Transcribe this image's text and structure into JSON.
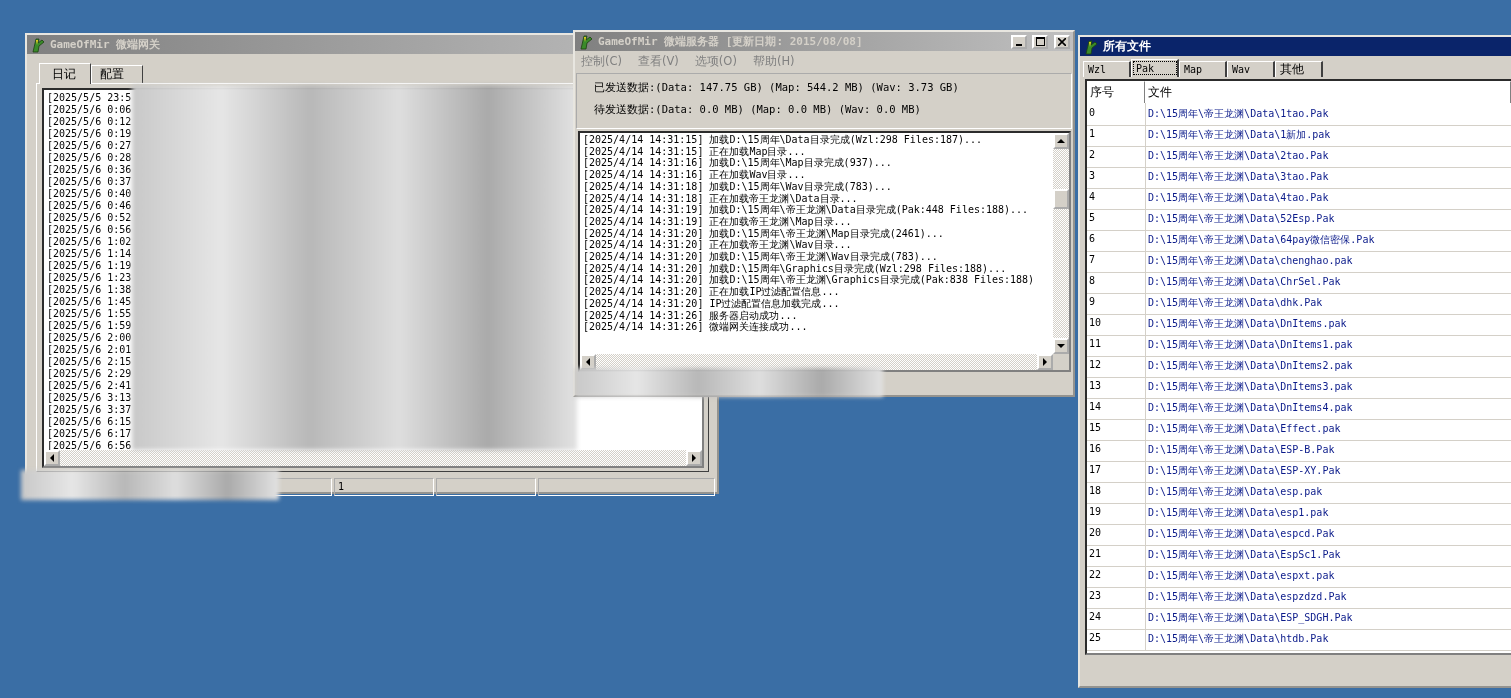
{
  "gateway_window": {
    "title": "GameOfMir 微端网关",
    "tabs": [
      {
        "label": "日记",
        "selected": true
      },
      {
        "label": "配置",
        "selected": false
      }
    ],
    "log_lines": [
      "[2025/5/5 23:5",
      "[2025/5/6 0:06",
      "[2025/5/6 0:12",
      "[2025/5/6 0:19",
      "[2025/5/6 0:27",
      "[2025/5/6 0:28",
      "[2025/5/6 0:36",
      "[2025/5/6 0:37",
      "[2025/5/6 0:40",
      "[2025/5/6 0:46",
      "[2025/5/6 0:52",
      "[2025/5/6 0:56",
      "[2025/5/6 1:02",
      "[2025/5/6 1:14",
      "[2025/5/6 1:19",
      "[2025/5/6 1:23",
      "[2025/5/6 1:38",
      "[2025/5/6 1:45",
      "[2025/5/6 1:55",
      "[2025/5/6 1:59",
      "[2025/5/6 2:00",
      "[2025/5/6 2:01",
      "[2025/5/6 2:15",
      "[2025/5/6 2:29",
      "[2025/5/6 2:41",
      "[2025/5/6 3:13",
      "[2025/5/6 3:37",
      "[2025/5/6 6:15",
      "[2025/5/6 6:17",
      "[2025/5/6 6:56"
    ],
    "status_text": "1"
  },
  "server_window": {
    "title": "GameOfMir 微端服务器 [更新日期: 2015/08/08]",
    "menu": [
      "控制(C)",
      "查看(V)",
      "选项(O)",
      "帮助(H)"
    ],
    "sent_stats": "已发送数据:(Data: 147.75 GB) (Map: 544.2 MB) (Wav: 3.73 GB)",
    "pending_stats": "待发送数据:(Data: 0.0 MB) (Map: 0.0 MB) (Wav: 0.0 MB)",
    "log_lines": [
      "[2025/4/14 14:31:15] 加载D:\\15周年\\Data目录完成(Wzl:298 Files:187)...",
      "[2025/4/14 14:31:15] 正在加载Map目录...",
      "[2025/4/14 14:31:16] 加载D:\\15周年\\Map目录完成(937)...",
      "[2025/4/14 14:31:16] 正在加载Wav目录...",
      "[2025/4/14 14:31:18] 加载D:\\15周年\\Wav目录完成(783)...",
      "[2025/4/14 14:31:18] 正在加载帝王龙渊\\Data目录...",
      "[2025/4/14 14:31:19] 加载D:\\15周年\\帝王龙渊\\Data目录完成(Pak:448 Files:188)...",
      "[2025/4/14 14:31:19] 正在加载帝王龙渊\\Map目录...",
      "[2025/4/14 14:31:20] 加载D:\\15周年\\帝王龙渊\\Map目录完成(2461)...",
      "[2025/4/14 14:31:20] 正在加载帝王龙渊\\Wav目录...",
      "[2025/4/14 14:31:20] 加载D:\\15周年\\帝王龙渊\\Wav目录完成(783)...",
      "[2025/4/14 14:31:20] 加载D:\\15周年\\Graphics目录完成(Wzl:298 Files:188)...",
      "[2025/4/14 14:31:20] 加载D:\\15周年\\帝王龙渊\\Graphics目录完成(Pak:838 Files:188)",
      "[2025/4/14 14:31:20] 正在加载IP过滤配置信息...",
      "[2025/4/14 14:31:20] IP过滤配置信息加载完成...",
      "[2025/4/14 14:31:26] 服务器启动成功...",
      "[2025/4/14 14:31:26] 微端网关连接成功..."
    ]
  },
  "files_window": {
    "title": "所有文件",
    "tabs": [
      {
        "label": "Wzl",
        "selected": false
      },
      {
        "label": "Pak",
        "selected": true
      },
      {
        "label": "Map",
        "selected": false
      },
      {
        "label": "Wav",
        "selected": false
      },
      {
        "label": "其他",
        "selected": false
      }
    ],
    "columns": [
      "序号",
      "文件"
    ],
    "rows": [
      {
        "index": "0",
        "file": "D:\\15周年\\帝王龙渊\\Data\\1tao.Pak"
      },
      {
        "index": "1",
        "file": "D:\\15周年\\帝王龙渊\\Data\\1新加.pak"
      },
      {
        "index": "2",
        "file": "D:\\15周年\\帝王龙渊\\Data\\2tao.Pak"
      },
      {
        "index": "3",
        "file": "D:\\15周年\\帝王龙渊\\Data\\3tao.Pak"
      },
      {
        "index": "4",
        "file": "D:\\15周年\\帝王龙渊\\Data\\4tao.Pak"
      },
      {
        "index": "5",
        "file": "D:\\15周年\\帝王龙渊\\Data\\52Esp.Pak"
      },
      {
        "index": "6",
        "file": "D:\\15周年\\帝王龙渊\\Data\\64pay微信密保.Pak"
      },
      {
        "index": "7",
        "file": "D:\\15周年\\帝王龙渊\\Data\\chenghao.pak"
      },
      {
        "index": "8",
        "file": "D:\\15周年\\帝王龙渊\\Data\\ChrSel.Pak"
      },
      {
        "index": "9",
        "file": "D:\\15周年\\帝王龙渊\\Data\\dhk.Pak"
      },
      {
        "index": "10",
        "file": "D:\\15周年\\帝王龙渊\\Data\\DnItems.pak"
      },
      {
        "index": "11",
        "file": "D:\\15周年\\帝王龙渊\\Data\\DnItems1.pak"
      },
      {
        "index": "12",
        "file": "D:\\15周年\\帝王龙渊\\Data\\DnItems2.pak"
      },
      {
        "index": "13",
        "file": "D:\\15周年\\帝王龙渊\\Data\\DnItems3.pak"
      },
      {
        "index": "14",
        "file": "D:\\15周年\\帝王龙渊\\Data\\DnItems4.pak"
      },
      {
        "index": "15",
        "file": "D:\\15周年\\帝王龙渊\\Data\\Effect.pak"
      },
      {
        "index": "16",
        "file": "D:\\15周年\\帝王龙渊\\Data\\ESP-B.Pak"
      },
      {
        "index": "17",
        "file": "D:\\15周年\\帝王龙渊\\Data\\ESP-XY.Pak"
      },
      {
        "index": "18",
        "file": "D:\\15周年\\帝王龙渊\\Data\\esp.pak"
      },
      {
        "index": "19",
        "file": "D:\\15周年\\帝王龙渊\\Data\\esp1.pak"
      },
      {
        "index": "20",
        "file": "D:\\15周年\\帝王龙渊\\Data\\espcd.Pak"
      },
      {
        "index": "21",
        "file": "D:\\15周年\\帝王龙渊\\Data\\EspSc1.Pak"
      },
      {
        "index": "22",
        "file": "D:\\15周年\\帝王龙渊\\Data\\espxt.pak"
      },
      {
        "index": "23",
        "file": "D:\\15周年\\帝王龙渊\\Data\\espzdzd.Pak"
      },
      {
        "index": "24",
        "file": "D:\\15周年\\帝王龙渊\\Data\\ESP_SDGH.Pak"
      },
      {
        "index": "25",
        "file": "D:\\15周年\\帝王龙渊\\Data\\htdb.Pak"
      }
    ]
  }
}
